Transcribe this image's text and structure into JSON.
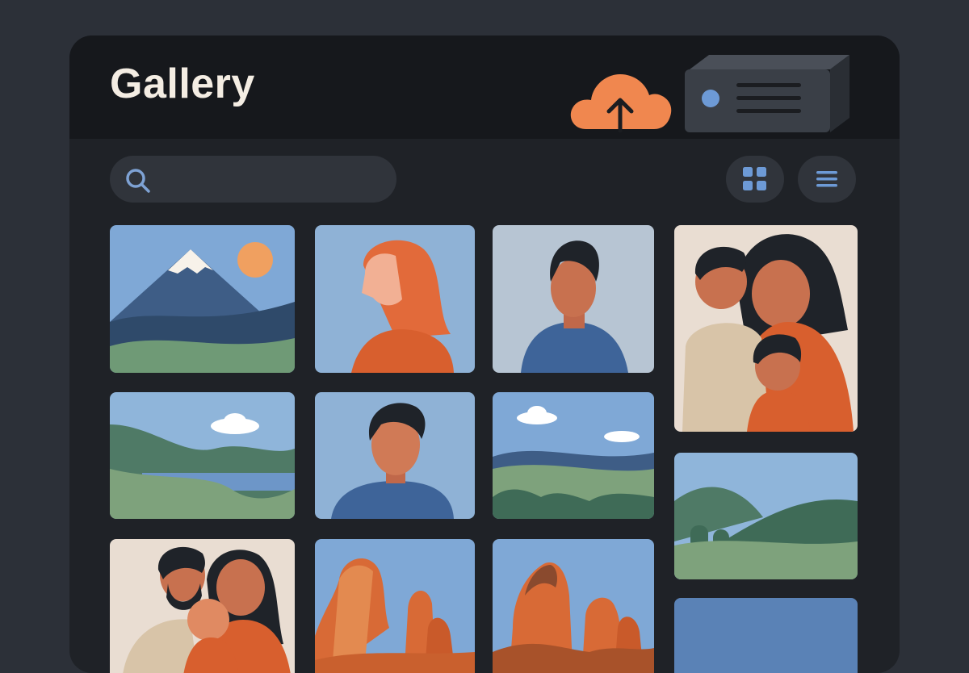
{
  "header": {
    "title": "Gallery",
    "upload_icon": "cloud-upload-icon",
    "device_icon": "storage-device-icon"
  },
  "search": {
    "placeholder": "",
    "icon": "search-icon"
  },
  "view_toggle": {
    "grid_icon": "grid-view-icon",
    "list_icon": "list-view-icon"
  },
  "photos": [
    {
      "subject": "mountain-landscape"
    },
    {
      "subject": "woman-portrait"
    },
    {
      "subject": "man-portrait"
    },
    {
      "subject": "family-portrait"
    },
    {
      "subject": "lake-landscape"
    },
    {
      "subject": "man-portrait"
    },
    {
      "subject": "hills-landscape"
    },
    {
      "subject": "hills-landscape"
    },
    {
      "subject": "family-with-baby"
    },
    {
      "subject": "desert-rocks"
    },
    {
      "subject": "desert-rocks"
    },
    {
      "subject": "sky"
    }
  ],
  "colors": {
    "background": "#2c3038",
    "panel": "#1f2227",
    "header": "#16181c",
    "accent": "#f0874f",
    "title": "#f4ede3",
    "icon_blue": "#6d9ad6"
  }
}
